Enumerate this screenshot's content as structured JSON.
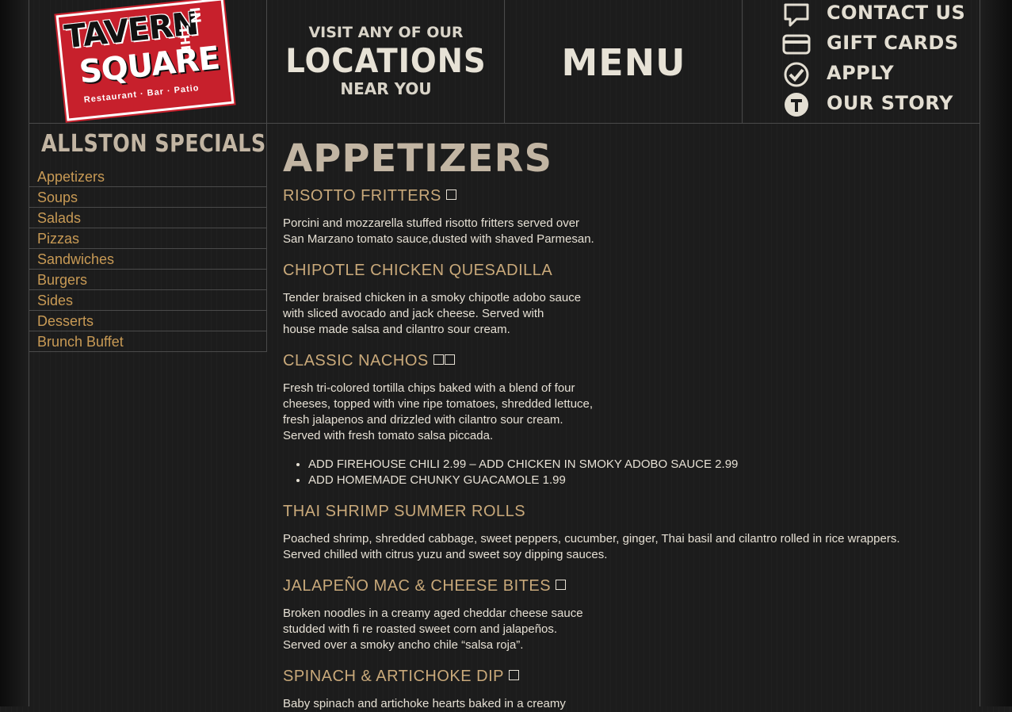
{
  "header": {
    "logo": {
      "tavern": "TAVERN",
      "in": "IN",
      "the": "THE",
      "square": "SQUARE",
      "tagline": "Restaurant  ·  Bar  ·  Patio"
    },
    "locations": {
      "line1": "VISIT ANY OF OUR",
      "line2": "LOCATIONS",
      "line3": "NEAR YOU"
    },
    "menu_label": "MENU",
    "nav": [
      {
        "label": "CONTACT US",
        "icon": "speech-bubble-icon"
      },
      {
        "label": "GIFT CARDS",
        "icon": "credit-card-icon"
      },
      {
        "label": "APPLY",
        "icon": "checkmark-icon"
      },
      {
        "label": "OUR STORY",
        "icon": "t-logo-icon"
      }
    ]
  },
  "sidebar": {
    "title": "ALLSTON SPECIALS",
    "items": [
      "Appetizers",
      "Soups",
      "Salads",
      "Pizzas",
      "Sandwiches",
      "Burgers",
      "Sides",
      "Desserts",
      "Brunch Buffet"
    ]
  },
  "content": {
    "title": "APPETIZERS",
    "items": [
      {
        "name": "RISOTTO FRITTERS",
        "badges": 1,
        "lines": [
          "Porcini and mozzarella stuffed risotto fritters served over",
          "San Marzano tomato sauce,dusted with shaved Parmesan."
        ]
      },
      {
        "name": "CHIPOTLE CHICKEN QUESADILLA",
        "badges": 0,
        "lines": [
          "Tender braised chicken in a smoky chipotle adobo sauce",
          "with sliced avocado and jack cheese. Served with",
          "house made salsa and cilantro sour cream."
        ]
      },
      {
        "name": "CLASSIC NACHOS",
        "badges": 2,
        "lines": [
          "Fresh tri-colored tortilla chips baked with a blend of four",
          "cheeses, topped with vine ripe tomatoes, shredded lettuce,",
          "fresh jalapenos and drizzled with cilantro sour cream.",
          "Served with fresh tomato salsa piccada."
        ],
        "addons": [
          "ADD FIREHOUSE CHILI 2.99 – ADD CHICKEN IN SMOKY ADOBO SAUCE 2.99",
          "ADD HOMEMADE CHUNKY GUACAMOLE 1.99"
        ]
      },
      {
        "name": "THAI SHRIMP SUMMER ROLLS",
        "badges": 0,
        "lines": [
          "Poached shrimp, shredded cabbage, sweet peppers, cucumber, ginger, Thai basil and cilantro rolled in rice wrappers.",
          "Served chilled with citrus yuzu and sweet soy dipping sauces."
        ]
      },
      {
        "name": "JALAPEÑO MAC & CHEESE BITES",
        "badges": 1,
        "lines": [
          "Broken noodles in a creamy aged cheddar cheese sauce",
          "studded with fi re roasted sweet corn and jalapeños.",
          "Served over a smoky ancho chile “salsa roja”."
        ]
      },
      {
        "name": "SPINACH & ARTICHOKE DIP",
        "badges": 1,
        "lines": [
          "Baby spinach and artichoke hearts baked in a creamy"
        ]
      }
    ]
  },
  "colors": {
    "background": "#1c1c1c",
    "link": "#c89a55",
    "heading": "#c9a97a",
    "body_text": "#e6e0d4",
    "logo_red": "#c7202c"
  }
}
